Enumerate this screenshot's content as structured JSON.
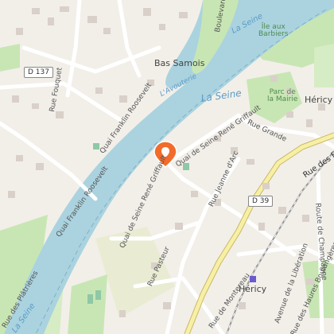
{
  "map": {
    "labels": {
      "river_1": "La Seine",
      "river_2": "La Seine",
      "river_3": "La Seine",
      "river_4": "La Seine",
      "bas_samois": "Bas Samois",
      "avouterie": "L'Avouterie",
      "ile_aux_barbiers": "Île aux\nBarbiers",
      "parc_mairie": "Parc de\nla Mairie",
      "hericy_top": "Héricy",
      "hericy_town": "Héricy",
      "rue_fouquet": "Rue Fouquet",
      "quai_franklin_1": "Quai Franklin Roosevelt",
      "quai_franklin_2": "Quai Franklin Roosevelt",
      "boulevard": "Boulevard",
      "quai_seine_1": "Quai de Seine René Griffault",
      "quai_seine_2": "Quai de Seine René Griffault",
      "rue_grande": "Rue Grande",
      "rue_jeanne_arc": "Rue Jeanne d'Arc",
      "rue_des_fossés": "Rue des Fossés",
      "route_champagne": "Route de Champagne",
      "avenue_liberation": "Avenue de la Libération",
      "rue_pasteur": "Rue Pasteur",
      "rue_haures": "Rue des Haures Boulangères",
      "rue_platrieres": "Rue des Plâtrières",
      "rue_montereau": "Rue de Montereau",
      "rue_ka": "Rue de la",
      "d137": "D 137",
      "d39": "D 39"
    },
    "colors": {
      "land": "#f2efe9",
      "water": "#aad3df",
      "park": "#c8e6b4",
      "building": "#d9d0c9",
      "road_yellow": "#f7f0a4",
      "marker": "#f26b2a"
    },
    "marker_icon": "map-pin-icon",
    "station_icon": "train-station-icon"
  }
}
